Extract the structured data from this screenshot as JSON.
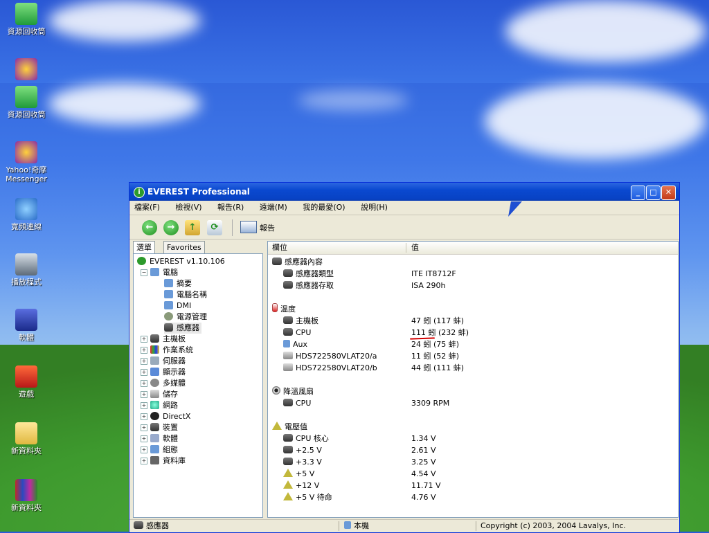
{
  "desktop": {
    "icons": [
      {
        "label": "資源回收筒"
      },
      {
        "label": ""
      },
      {
        "label": "資源回收筒"
      },
      {
        "label": "Yahoo!奇摩 Messenger"
      },
      {
        "label": "寬頻連線"
      },
      {
        "label": "播放程式"
      },
      {
        "label": "軟體"
      },
      {
        "label": "遊戲"
      },
      {
        "label": "新資料夾"
      },
      {
        "label": "新資料夾"
      }
    ]
  },
  "window": {
    "title": "EVEREST Professional",
    "menu": [
      "檔案(F)",
      "檢視(V)",
      "報告(R)",
      "遠端(M)",
      "我的最愛(O)",
      "說明(H)"
    ],
    "toolbar": {
      "report_label": "報告"
    },
    "tabs": [
      "選單",
      "Favorites"
    ],
    "tree": {
      "root": "EVEREST v1.10.106",
      "computer": "電腦",
      "computer_children": [
        "摘要",
        "電腦名稱",
        "DMI",
        "電源管理",
        "感應器"
      ],
      "categories": [
        "主機板",
        "作業系統",
        "伺服器",
        "顯示器",
        "多媒體",
        "儲存",
        "網路",
        "DirectX",
        "裝置",
        "軟體",
        "組態",
        "資料庫"
      ]
    },
    "list": {
      "col_field": "欄位",
      "col_value": "值",
      "groups": [
        {
          "title": "感應器內容",
          "rows": [
            {
              "field": "感應器類型",
              "value": "ITE IT8712F"
            },
            {
              "field": "感應器存取",
              "value": "ISA 290h"
            }
          ]
        },
        {
          "title": "溫度",
          "rows": [
            {
              "field": "主機板",
              "value": "47 蚓 (117 蚌)"
            },
            {
              "field": "CPU",
              "value": "111 蚓 (232 蚌)"
            },
            {
              "field": "Aux",
              "value": "24 蚓 (75 蚌)"
            },
            {
              "field": "HDS722580VLAT20/a",
              "value": "11 蚓 (52 蚌)"
            },
            {
              "field": "HDS722580VLAT20/b",
              "value": "44 蚓 (111 蚌)"
            }
          ]
        },
        {
          "title": "降溫風扇",
          "rows": [
            {
              "field": "CPU",
              "value": "3309 RPM"
            }
          ]
        },
        {
          "title": "電壓值",
          "rows": [
            {
              "field": "CPU 核心",
              "value": "1.34 V"
            },
            {
              "field": "+2.5 V",
              "value": "2.61 V"
            },
            {
              "field": "+3.3 V",
              "value": "3.25 V"
            },
            {
              "field": "+5 V",
              "value": "4.54 V"
            },
            {
              "field": "+12 V",
              "value": "11.71 V"
            },
            {
              "field": "+5 V 待命",
              "value": "4.76 V"
            }
          ]
        }
      ]
    },
    "status": {
      "left": "感應器",
      "middle": "本機",
      "right": "Copyright (c) 2003, 2004 Lavalys, Inc."
    }
  },
  "colors": {
    "title_bar": "#0a49d0",
    "underline": "#d40000"
  }
}
